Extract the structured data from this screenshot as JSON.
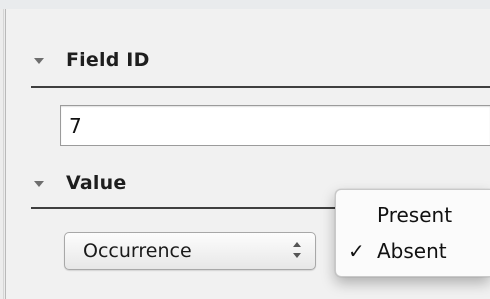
{
  "field_id_section": {
    "label": "Field ID",
    "value": "7"
  },
  "value_section": {
    "label": "Value",
    "popup_value": "Occurrence"
  },
  "menu": {
    "items": [
      {
        "label": "Present",
        "checked": false,
        "check": ""
      },
      {
        "label": "Absent",
        "checked": true,
        "check": "✓"
      }
    ]
  },
  "icons": {
    "disclosure": "disclosure-triangle-icon",
    "popup_arrows": "up-down-chevron-icon",
    "checkmark": "checkmark-icon"
  }
}
